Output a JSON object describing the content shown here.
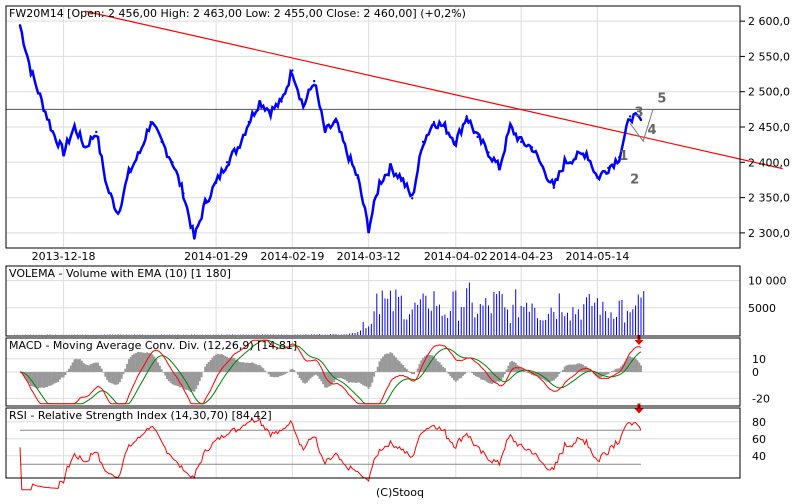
{
  "chart_data": {
    "type": "line",
    "title": "FW20M14 [Open: 2 456,00  High: 2 463,00  Low: 2 455,00  Close: 2 460,00] (+0,2%)",
    "footer": "(C)Stooq",
    "colors": {
      "price": "#0000ff",
      "trend": "#ff0000",
      "macd": "#ff0000",
      "signal": "#008000",
      "hist": "#999999",
      "rsi": "#ff0000",
      "volume": "#0000ff"
    },
    "price": {
      "ylim": [
        2280,
        2620
      ],
      "yticks": [
        2300,
        2350,
        2400,
        2450,
        2500,
        2550,
        2600
      ],
      "ytick_labels": [
        "2 300,0",
        "2 350,0",
        "2 400,0",
        "2 450,0",
        "2 500,0",
        "2 550,0",
        "2 600,0"
      ],
      "values": [
        2594,
        2530,
        2486,
        2443,
        2414,
        2450,
        2421,
        2443,
        2364,
        2328,
        2385,
        2414,
        2457,
        2429,
        2400,
        2356,
        2292,
        2342,
        2371,
        2400,
        2421,
        2457,
        2486,
        2472,
        2486,
        2530,
        2479,
        2515,
        2443,
        2457,
        2414,
        2378,
        2306,
        2371,
        2392,
        2378,
        2349,
        2429,
        2457,
        2450,
        2429,
        2465,
        2436,
        2414,
        2392,
        2450,
        2429,
        2421,
        2392,
        2364,
        2400,
        2407,
        2414,
        2378,
        2392,
        2407,
        2465,
        2460
      ],
      "xticks": [
        {
          "index": 4,
          "label": "2013-12-18"
        },
        {
          "index": 18,
          "label": "2014-01-29"
        },
        {
          "index": 25,
          "label": "2014-02-19"
        },
        {
          "index": 32,
          "label": "2014-03-12"
        },
        {
          "index": 40,
          "label": "2014-04-02"
        },
        {
          "index": 46,
          "label": "2014-04-23"
        },
        {
          "index": 53,
          "label": "2014-05-14"
        }
      ],
      "trendline": {
        "start": [
          6,
          2614
        ],
        "end": [
          70,
          2391
        ]
      },
      "hline": 2475,
      "wave_labels": [
        {
          "label": "1",
          "index": 55,
          "value": 2403
        },
        {
          "label": "2",
          "index": 56,
          "value": 2370
        },
        {
          "label": "3",
          "index": 56.4,
          "value": 2465
        },
        {
          "label": "4",
          "index": 57.6,
          "value": 2440
        },
        {
          "label": "5",
          "index": 58.5,
          "value": 2485
        }
      ]
    },
    "volume": {
      "title": "VOLEMA - Volume with EMA (10) [1 180]",
      "yticks": [
        5000,
        10000
      ],
      "ytick_labels": [
        "5000",
        "10 000"
      ],
      "ylim": [
        0,
        12500
      ],
      "values": [
        50,
        60,
        40,
        80,
        60,
        50,
        70,
        60,
        90,
        80,
        60,
        70,
        50,
        60,
        80,
        70,
        90,
        60,
        50,
        70,
        80,
        60,
        90,
        100,
        80,
        70,
        90,
        110,
        120,
        150,
        200,
        900,
        2500,
        9000,
        6500,
        7000,
        5500,
        6000,
        8000,
        5000,
        6500,
        7500,
        5500,
        6000,
        7000,
        5000,
        6500,
        8000,
        5000,
        6000,
        7500,
        5500,
        6000,
        7000,
        5000,
        6500,
        4000,
        7500
      ]
    },
    "macd": {
      "title": "MACD - Moving Average Conv. Div. (12,26,9) [14,81]",
      "yticks": [
        -20,
        0,
        10
      ],
      "ytick_labels": [
        "-20",
        "0",
        "10"
      ],
      "ylim": [
        -25,
        25
      ]
    },
    "rsi": {
      "title": "RSI - Relative Strength Index (14,30,70) [84,42]",
      "yticks": [
        40,
        60,
        80
      ],
      "ytick_labels": [
        "40",
        "60",
        "80"
      ],
      "ylim": [
        15,
        95
      ],
      "levels": [
        30,
        70
      ]
    }
  }
}
